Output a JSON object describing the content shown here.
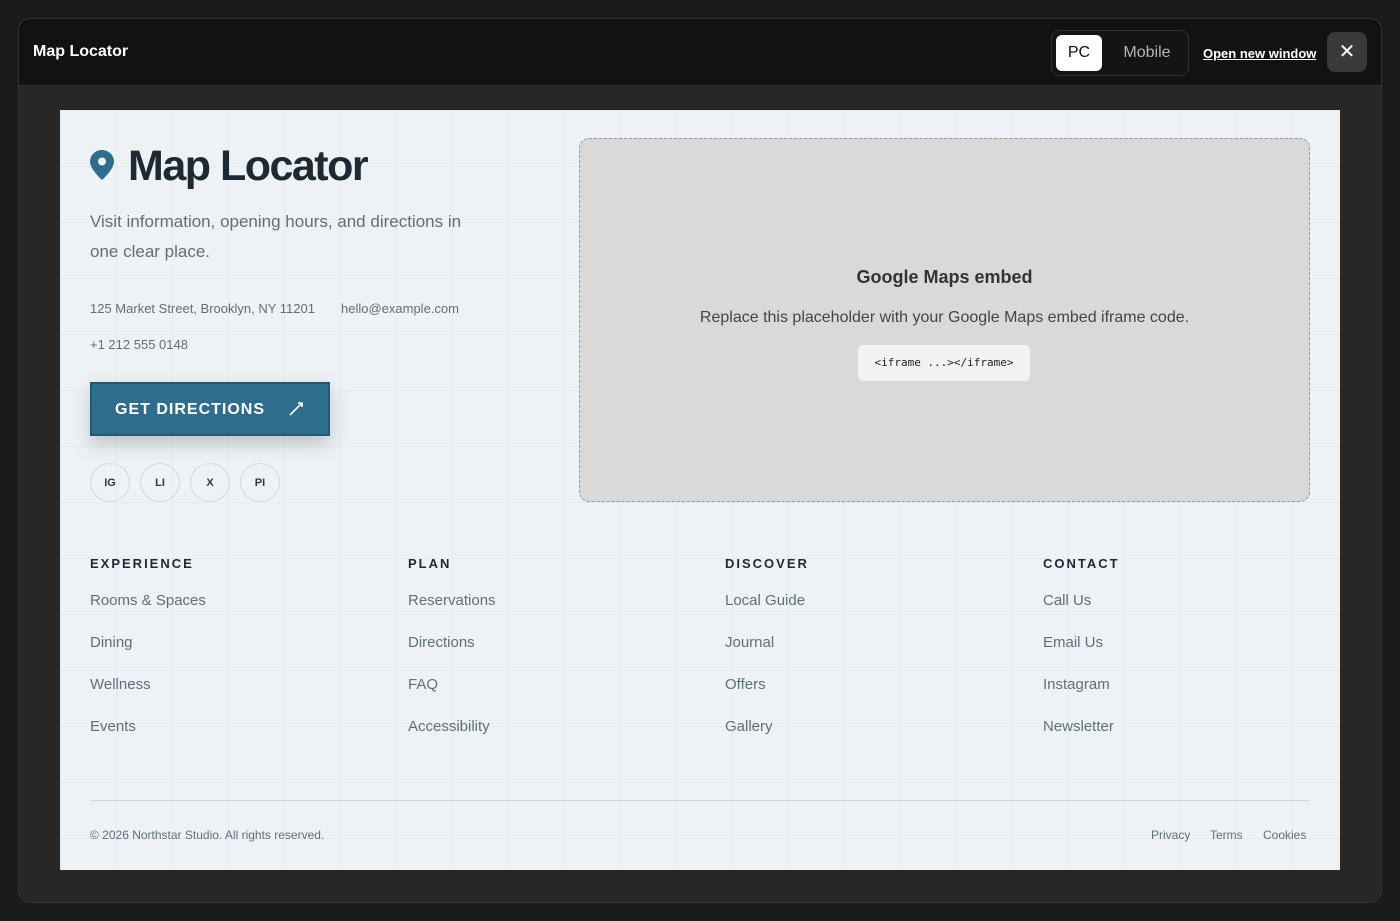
{
  "window": {
    "title": "Map Locator",
    "view_modes": [
      "PC",
      "Mobile"
    ],
    "active_view": "PC",
    "open_new_window": "Open new window",
    "close_label": "✕"
  },
  "brand": {
    "title": "Map Locator",
    "tagline": "Visit information, opening hours, and directions in one clear place."
  },
  "contact": {
    "address": "125 Market Street, Brooklyn, NY 11201",
    "email": "hello@example.com",
    "phone": "+1 212 555 0148"
  },
  "cta": {
    "label": "GET DIRECTIONS"
  },
  "socials": [
    "IG",
    "LI",
    "X",
    "PI"
  ],
  "map": {
    "title": "Google Maps embed",
    "description": "Replace this placeholder with your Google Maps embed iframe code.",
    "code": "<iframe ...></iframe>"
  },
  "footer": {
    "columns": [
      {
        "heading": "EXPERIENCE",
        "links": [
          "Rooms & Spaces",
          "Dining",
          "Wellness",
          "Events"
        ]
      },
      {
        "heading": "PLAN",
        "links": [
          "Reservations",
          "Directions",
          "FAQ",
          "Accessibility"
        ]
      },
      {
        "heading": "DISCOVER",
        "links": [
          "Local Guide",
          "Journal",
          "Offers",
          "Gallery"
        ]
      },
      {
        "heading": "CONTACT",
        "links": [
          "Call Us",
          "Email Us",
          "Instagram",
          "Newsletter"
        ]
      }
    ],
    "copyright": "© 2026 Northstar Studio. All rights reserved.",
    "legal": [
      "Privacy",
      "Terms",
      "Cookies"
    ]
  },
  "colors": {
    "accent": "#2e6e8c",
    "page_bg": "#eef2f5",
    "text_dark": "#1d2a33",
    "text_muted": "#5f6f7a"
  }
}
